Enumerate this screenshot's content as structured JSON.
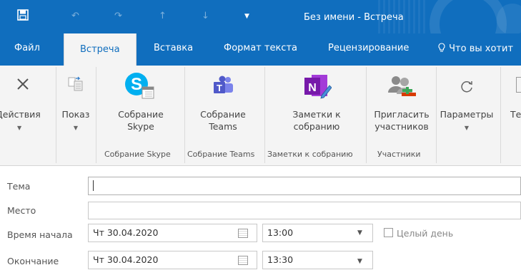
{
  "window": {
    "title": "Без имени - Встреча"
  },
  "tabs": [
    "Файл",
    "Встреча",
    "Вставка",
    "Формат текста",
    "Рецензирование",
    "Что вы хотит"
  ],
  "ribbon": {
    "actions_label": "Действия",
    "show_label": "Показ",
    "skype_label_1": "Собрание",
    "skype_label_2": "Skype",
    "teams_label_1": "Собрание",
    "teams_label_2": "Teams",
    "notes_label_1": "Заметки к",
    "notes_label_2": "собранию",
    "invite_label_1": "Пригласить",
    "invite_label_2": "участников",
    "params_label": "Параметры",
    "last_label": "Те",
    "groups": {
      "skype": "Собрание Skype",
      "teams": "Собрание Teams",
      "notes": "Заметки к собранию",
      "attendees": "Участники"
    }
  },
  "form": {
    "subject_label": "Тема",
    "subject_value": "",
    "location_label": "Место",
    "location_value": "",
    "start_label": "Время начала",
    "start_date": "Чт 30.04.2020",
    "start_time": "13:00",
    "allday_label": "Целый день",
    "end_label": "Окончание",
    "end_date": "Чт 30.04.2020",
    "end_time": "13:30"
  },
  "colors": {
    "title_bar": "#106ebe",
    "skype": "#00aff0",
    "teams": "#5059c9",
    "onenote": "#7719aa"
  }
}
